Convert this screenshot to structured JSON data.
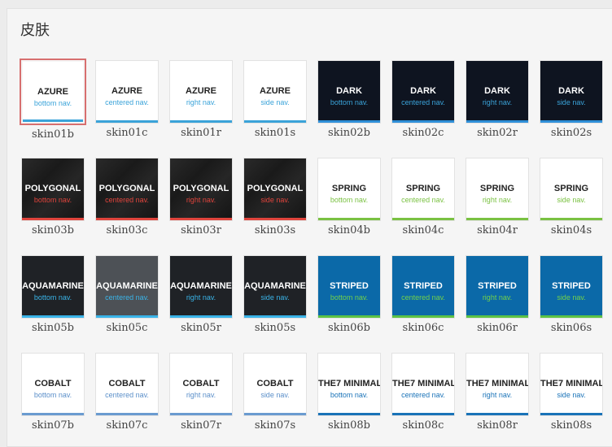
{
  "panel": {
    "title": "皮肤"
  },
  "rows": [
    {
      "theme": "light",
      "name_color": "#222222",
      "sub_color": "#3aa3d9",
      "bar_color": "#3aa3d9",
      "skins": [
        {
          "name": "AZURE",
          "sub": "bottom nav.",
          "label": "skin01b",
          "selected": true
        },
        {
          "name": "AZURE",
          "sub": "centered nav.",
          "label": "skin01c"
        },
        {
          "name": "AZURE",
          "sub": "right nav.",
          "label": "skin01r"
        },
        {
          "name": "AZURE",
          "sub": "side nav.",
          "label": "skin01s"
        }
      ]
    },
    {
      "theme": "dark",
      "name_color": "#ffffff",
      "sub_color": "#3aa3d9",
      "bar_color": "#2f8fd8",
      "skins": [
        {
          "name": "DARK",
          "sub": "bottom nav.",
          "label": "skin02b"
        },
        {
          "name": "DARK",
          "sub": "centered nav.",
          "label": "skin02c"
        },
        {
          "name": "DARK",
          "sub": "right nav.",
          "label": "skin02r"
        },
        {
          "name": "DARK",
          "sub": "side nav.",
          "label": "skin02s"
        }
      ]
    },
    {
      "theme": "poly",
      "name_color": "#ffffff",
      "sub_color": "#e0443c",
      "bar_color": "#e0443c",
      "skins": [
        {
          "name": "POLYGONAL",
          "sub": "bottom nav.",
          "label": "skin03b"
        },
        {
          "name": "POLYGONAL",
          "sub": "centered nav.",
          "label": "skin03c"
        },
        {
          "name": "POLYGONAL",
          "sub": "right nav.",
          "label": "skin03r"
        },
        {
          "name": "POLYGONAL",
          "sub": "side nav.",
          "label": "skin03s"
        }
      ]
    },
    {
      "theme": "light",
      "name_color": "#222222",
      "sub_color": "#7ac142",
      "bar_color": "#7ac142",
      "skins": [
        {
          "name": "SPRING",
          "sub": "bottom nav.",
          "label": "skin04b"
        },
        {
          "name": "SPRING",
          "sub": "centered nav.",
          "label": "skin04c"
        },
        {
          "name": "SPRING",
          "sub": "right nav.",
          "label": "skin04r"
        },
        {
          "name": "SPRING",
          "sub": "side nav.",
          "label": "skin04s"
        }
      ]
    },
    {
      "theme": "aqua",
      "name_color": "#ffffff",
      "sub_color": "#3ab4e8",
      "bar_color": "#3ab4e8",
      "skins": [
        {
          "name": "AQUAMARINE",
          "sub": "bottom nav.",
          "label": "skin05b"
        },
        {
          "name": "AQUAMARINE",
          "sub": "centered nav.",
          "label": "skin05c",
          "alt": true
        },
        {
          "name": "AQUAMARINE",
          "sub": "right nav.",
          "label": "skin05r"
        },
        {
          "name": "AQUAMARINE",
          "sub": "side nav.",
          "label": "skin05s"
        }
      ]
    },
    {
      "theme": "striped",
      "name_color": "#ffffff",
      "sub_color": "#72d14a",
      "bar_color": "#5cc245",
      "skins": [
        {
          "name": "STRIPED",
          "sub": "bottom nav.",
          "label": "skin06b"
        },
        {
          "name": "STRIPED",
          "sub": "centered nav.",
          "label": "skin06c"
        },
        {
          "name": "STRIPED",
          "sub": "right nav.",
          "label": "skin06r"
        },
        {
          "name": "STRIPED",
          "sub": "side nav.",
          "label": "skin06s"
        }
      ]
    },
    {
      "theme": "light",
      "name_color": "#222222",
      "sub_color": "#5b8fc9",
      "bar_color": "#6a9bd0",
      "skins": [
        {
          "name": "COBALT",
          "sub": "bottom nav.",
          "label": "skin07b"
        },
        {
          "name": "COBALT",
          "sub": "centered nav.",
          "label": "skin07c"
        },
        {
          "name": "COBALT",
          "sub": "right nav.",
          "label": "skin07r"
        },
        {
          "name": "COBALT",
          "sub": "side nav.",
          "label": "skin07s"
        }
      ]
    },
    {
      "theme": "light",
      "name_color": "#222222",
      "sub_color": "#1a73b8",
      "bar_color": "#1a73b8",
      "skins": [
        {
          "name": "THE7 MINIMAL",
          "sub": "bottom nav.",
          "label": "skin08b"
        },
        {
          "name": "THE7 MINIMAL",
          "sub": "centered nav.",
          "label": "skin08c"
        },
        {
          "name": "THE7 MINIMAL",
          "sub": "right nav.",
          "label": "skin08r"
        },
        {
          "name": "THE7 MINIMAL",
          "sub": "side nav.",
          "label": "skin08s"
        }
      ]
    }
  ]
}
